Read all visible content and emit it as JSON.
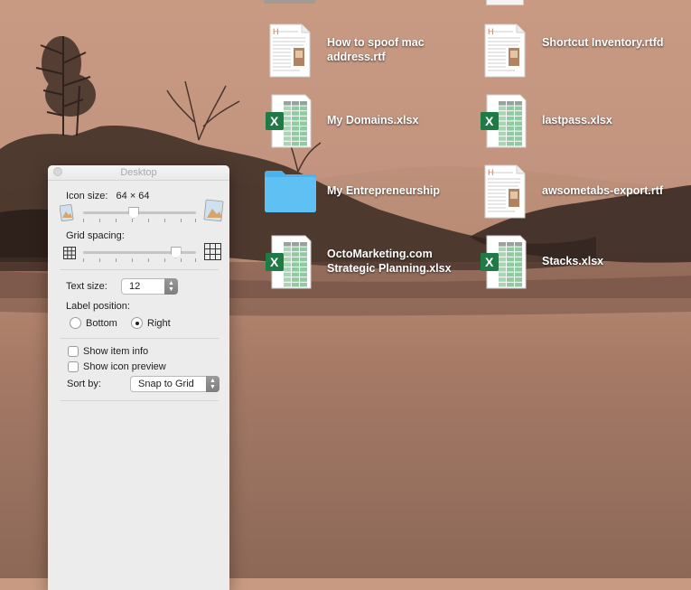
{
  "desktop": {
    "files": [
      {
        "name": "How to spoof mac address.rtf",
        "kind": "rtf"
      },
      {
        "name": "Shortcut Inventory.rtfd",
        "kind": "rtf"
      },
      {
        "name": "My Domains.xlsx",
        "kind": "xlsx"
      },
      {
        "name": "lastpass.xlsx",
        "kind": "xlsx"
      },
      {
        "name": "My Entrepreneurship",
        "kind": "folder"
      },
      {
        "name": "awsometabs-export.rtf",
        "kind": "rtf"
      },
      {
        "name": "OctoMarketing.com Strategic Planning.xlsx",
        "kind": "xlsx"
      },
      {
        "name": "Stacks.xlsx",
        "kind": "xlsx"
      }
    ]
  },
  "panel": {
    "title": "Desktop",
    "icon_size_label": "Icon size:",
    "icon_size_value": "64 × 64",
    "icon_size_level": 0.45,
    "grid_spacing_label": "Grid spacing:",
    "grid_spacing_level": 0.82,
    "text_size_label": "Text size:",
    "text_size_value": "12",
    "label_position_label": "Label position:",
    "label_position_options": [
      "Bottom",
      "Right"
    ],
    "label_position_selected": "Right",
    "show_item_info_label": "Show item info",
    "show_item_info_checked": false,
    "show_icon_preview_label": "Show icon preview",
    "show_icon_preview_checked": false,
    "sort_by_label": "Sort by:",
    "sort_by_value": "Snap to Grid"
  },
  "colors": {
    "excel_green": "#1f7a46",
    "folder_blue": "#5fc0f3",
    "rtf_header": "#e8692e"
  }
}
